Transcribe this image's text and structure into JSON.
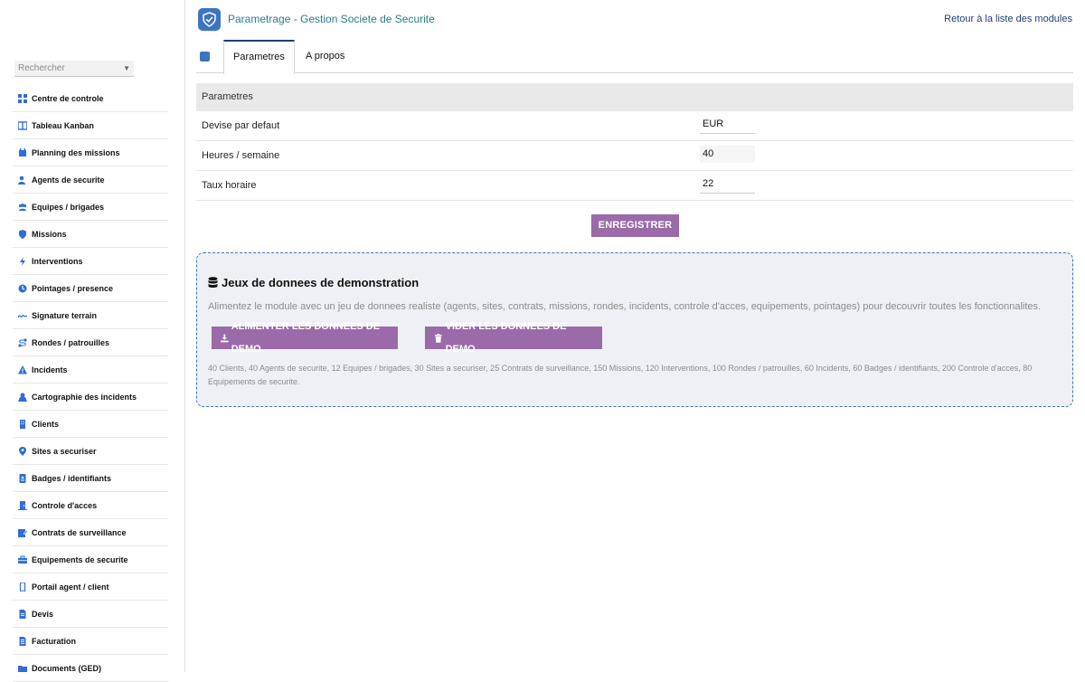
{
  "header": {
    "title": "Parametrage - Gestion Societe de Securite",
    "back_link": "Retour à la liste des modules"
  },
  "search": {
    "placeholder": "Rechercher"
  },
  "sidebar": {
    "items": [
      {
        "label": "Centre de controle",
        "icon": "grid-icon"
      },
      {
        "label": "Tableau Kanban",
        "icon": "kanban-icon"
      },
      {
        "label": "Planning des missions",
        "icon": "calendar-icon"
      },
      {
        "label": "Agents de securite",
        "icon": "user-shield-icon"
      },
      {
        "label": "Equipes / brigades",
        "icon": "users-icon"
      },
      {
        "label": "Missions",
        "icon": "shield-icon"
      },
      {
        "label": "Interventions",
        "icon": "bolt-icon"
      },
      {
        "label": "Pointages / presence",
        "icon": "clock-icon"
      },
      {
        "label": "Signature terrain",
        "icon": "signature-icon"
      },
      {
        "label": "Rondes / patrouilles",
        "icon": "route-icon"
      },
      {
        "label": "Incidents",
        "icon": "warning-icon"
      },
      {
        "label": "Cartographie des incidents",
        "icon": "map-icon"
      },
      {
        "label": "Clients",
        "icon": "building-icon"
      },
      {
        "label": "Sites a securiser",
        "icon": "pin-icon"
      },
      {
        "label": "Badges / identifiants",
        "icon": "badge-icon"
      },
      {
        "label": "Controle d'acces",
        "icon": "door-icon"
      },
      {
        "label": "Contrats de surveillance",
        "icon": "contract-icon"
      },
      {
        "label": "Equipements de securite",
        "icon": "toolbox-icon"
      },
      {
        "label": "Portail agent / client",
        "icon": "mobile-icon"
      },
      {
        "label": "Devis",
        "icon": "file-icon"
      },
      {
        "label": "Facturation",
        "icon": "invoice-icon"
      },
      {
        "label": "Documents (GED)",
        "icon": "folder-icon"
      }
    ]
  },
  "tabs": [
    {
      "label": "Parametres",
      "active": true
    },
    {
      "label": "A propos",
      "active": false
    }
  ],
  "params": {
    "section_title": "Parametres",
    "rows": [
      {
        "label": "Devise par defaut",
        "value": "EUR"
      },
      {
        "label": "Heures / semaine",
        "value": "40"
      },
      {
        "label": "Taux horaire",
        "value": "22"
      }
    ],
    "save_label": "ENREGISTRER"
  },
  "demo": {
    "title": "Jeux de donnees de demonstration",
    "description": "Alimentez le module avec un jeu de donnees realiste (agents, sites, contrats, missions, rondes, incidents, controle d'acces, equipements, pointages) pour decouvrir toutes les fonctionnalites.",
    "feed_label": "ALIMENTER LES DONNEES DE DEMO",
    "clear_label": "VIDER LES DONNEES DE DEMO",
    "stats": "40 Clients, 40 Agents de securite, 12 Equipes / brigades, 30 Sites a securiser, 25 Contrats de surveillance, 150 Missions, 120 Interventions, 100 Rondes / patrouilles, 60 Incidents, 60 Badges / identifiants, 200 Controle d'acces, 80 Equipements de securite."
  },
  "colors": {
    "accent": "#9b6aa8",
    "brand": "#3d74c2",
    "link": "#1e3f77",
    "title": "#2b7c8b"
  }
}
